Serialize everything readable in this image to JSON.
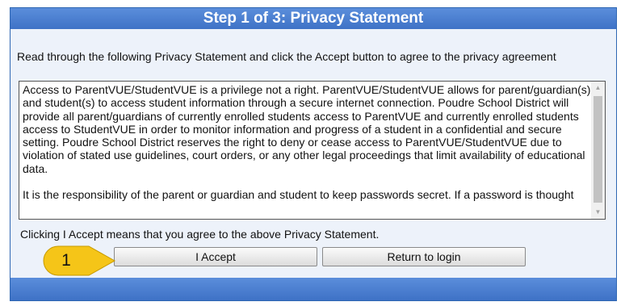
{
  "dialog": {
    "title": "Step 1 of 3: Privacy Statement",
    "instructions": "Read through the following Privacy Statement and click the Accept button to agree to the privacy agreement",
    "statement_paragraph_1": "Access to ParentVUE/StudentVUE is a privilege not a right. ParentVUE/StudentVUE allows for parent/guardian(s) and student(s) to access student information through a secure internet connection. Poudre School District will provide all parent/guardians of currently enrolled students access to ParentVUE and currently enrolled students access to StudentVUE in order to monitor information and progress of a student in a confidential and secure setting. Poudre School District reserves the right to deny or cease access to ParentVUE/StudentVUE due to violation of stated use guidelines, court orders, or any other legal proceedings that limit availability of educational data.",
    "statement_paragraph_2_partial": "It is the responsibility of the parent or guardian and student to keep passwords secret. If a password is thought",
    "agree_text": "Clicking I Accept means that you agree to the above Privacy Statement.",
    "accept_label": "I Accept",
    "return_label": "Return to login"
  },
  "callout": {
    "number": "1",
    "color": "#f5c518"
  },
  "colors": {
    "title_bar": "#3e72c6",
    "dialog_background": "#edf2fa"
  },
  "icons": {
    "scroll_up": "scroll-up-arrow-icon",
    "scroll_down": "scroll-down-arrow-icon",
    "callout": "callout-arrow-icon"
  }
}
